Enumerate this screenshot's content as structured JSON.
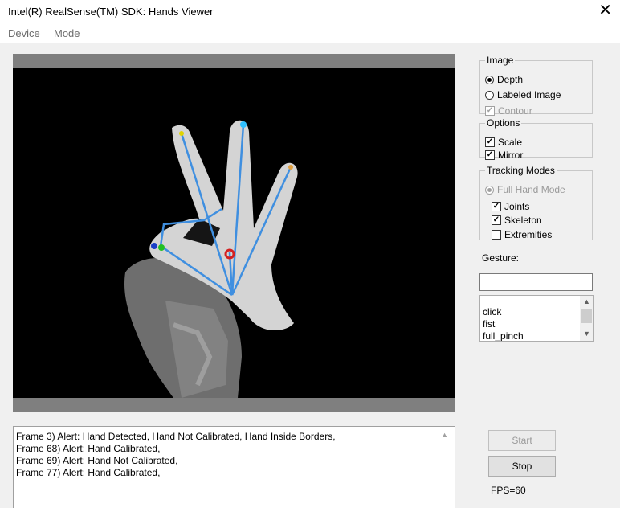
{
  "window": {
    "title": "Intel(R) RealSense(TM) SDK: Hands Viewer",
    "close_glyph": "✕"
  },
  "menu": [
    "Device",
    "Mode"
  ],
  "image_group": {
    "legend": "Image",
    "depth": "Depth",
    "labeled": "Labeled Image",
    "contour": "Contour",
    "selected": "Depth"
  },
  "options_group": {
    "legend": "Options",
    "scale": "Scale",
    "mirror": "Mirror"
  },
  "tracking_group": {
    "legend": "Tracking Modes",
    "full_hand": "Full Hand Mode",
    "joints": "Joints",
    "skeleton": "Skeleton",
    "extremities": "Extremities"
  },
  "gesture": {
    "label": "Gesture:",
    "value": "",
    "list": [
      "click",
      "fist",
      "full_pinch"
    ]
  },
  "log": [
    "Frame 3)  Alert: Hand Detected, Hand Not Calibrated, Hand Inside Borders,",
    "Frame 68)  Alert: Hand Calibrated,",
    "Frame 69)  Alert: Hand Not Calibrated,",
    "Frame 77)  Alert: Hand Calibrated,"
  ],
  "buttons": {
    "start": "Start",
    "stop": "Stop"
  },
  "fps": "FPS=60",
  "icons": [
    "close-icon",
    "radio-icon",
    "checkbox-icon",
    "scroll-up-icon",
    "scroll-down-icon"
  ],
  "colors": {
    "skeleton": "#3f8fe0",
    "joint_palm": "#d42020",
    "joint_green": "#22c022",
    "joint_blue": "#1a3fc8"
  }
}
